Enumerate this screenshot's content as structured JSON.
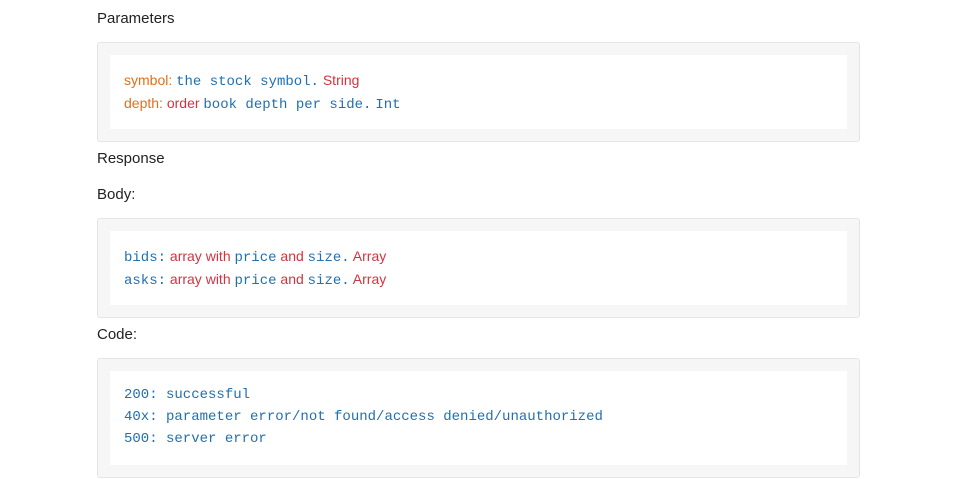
{
  "parameters": {
    "heading": "Parameters",
    "symbol": {
      "key": "symbol:",
      "desc": "the stock symbol.",
      "type": "String"
    },
    "depth": {
      "key": "depth:",
      "desc_red": "order",
      "desc_blue": "book depth per side.",
      "type": "Int"
    }
  },
  "response": {
    "heading": "Response",
    "body_heading": "Body:",
    "bids": {
      "key": "bids:",
      "w1": "array",
      "w2": "with",
      "w3": "price",
      "w4": "and",
      "w5": "size.",
      "type": "Array"
    },
    "asks": {
      "key": "asks:",
      "w1": "array",
      "w2": "with",
      "w3": "price",
      "w4": "and",
      "w5": "size.",
      "type": "Array"
    },
    "code_heading": "Code:",
    "codes": [
      "200: successful",
      "40x: parameter error/not found/access denied/unauthorized",
      "500: server error"
    ]
  },
  "colors": {
    "key_blue": "#1f6fb2",
    "keyword_red": "#d1343f",
    "param_orange": "#e0701a"
  }
}
